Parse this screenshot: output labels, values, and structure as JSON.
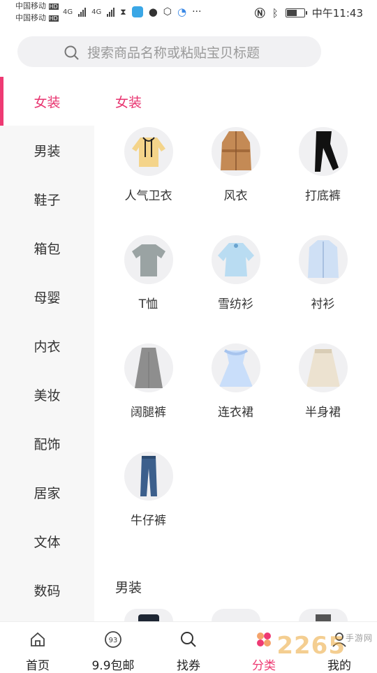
{
  "status_bar": {
    "carrier1": "中国移动",
    "carrier2": "中国移动",
    "hd": "HD",
    "net1": "4G",
    "net2": "4G",
    "clock": "中午11:43",
    "battery_level": 0.6
  },
  "search": {
    "placeholder": "搜索商品名称或粘贴宝贝标题"
  },
  "sidebar": {
    "items": [
      {
        "label": "女装",
        "active": true
      },
      {
        "label": "男装"
      },
      {
        "label": "鞋子"
      },
      {
        "label": "箱包"
      },
      {
        "label": "母婴"
      },
      {
        "label": "内衣"
      },
      {
        "label": "美妆"
      },
      {
        "label": "配饰"
      },
      {
        "label": "居家"
      },
      {
        "label": "文体"
      },
      {
        "label": "数码"
      }
    ]
  },
  "sections": [
    {
      "title": "女装",
      "items": [
        {
          "label": "人气卫衣",
          "icon": "hoodie-image"
        },
        {
          "label": "风衣",
          "icon": "trench-coat-image"
        },
        {
          "label": "打底裤",
          "icon": "leggings-image"
        },
        {
          "label": "T恤",
          "icon": "tshirt-image"
        },
        {
          "label": "雪纺衫",
          "icon": "chiffon-shirt-image"
        },
        {
          "label": "衬衫",
          "icon": "shirt-image"
        },
        {
          "label": "阔腿裤",
          "icon": "wide-leg-pants-image"
        },
        {
          "label": "连衣裙",
          "icon": "dress-image"
        },
        {
          "label": "半身裙",
          "icon": "skirt-image"
        },
        {
          "label": "牛仔裤",
          "icon": "jeans-image"
        }
      ]
    },
    {
      "title": "男装"
    }
  ],
  "tabbar": {
    "items": [
      {
        "label": "首页",
        "icon": "home-icon"
      },
      {
        "label": "9.9包邮",
        "icon": "coupon-99-icon"
      },
      {
        "label": "找券",
        "icon": "search-icon"
      },
      {
        "label": "分类",
        "icon": "category-icon",
        "active": true
      },
      {
        "label": "我的",
        "icon": "user-icon"
      }
    ]
  },
  "watermark": {
    "text": "2265",
    "sub": "手游网"
  },
  "colors": {
    "accent": "#ee3a73",
    "sidebar_bg": "#f7f7f7"
  }
}
